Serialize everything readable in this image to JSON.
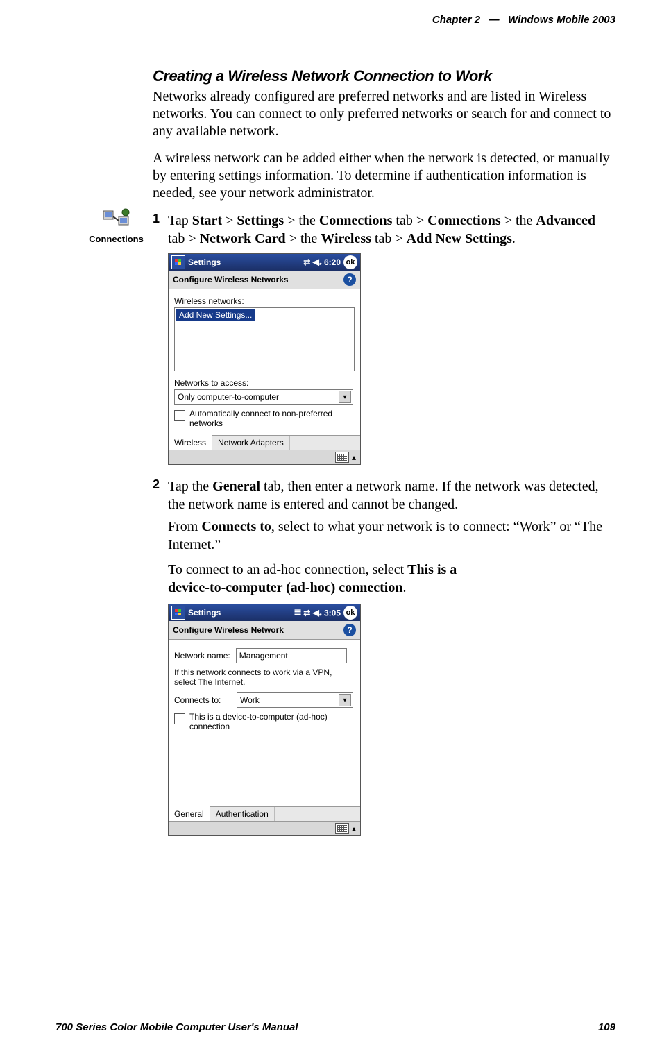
{
  "header": {
    "chapter_label": "Chapter",
    "chapter_number": "2",
    "dash": "—",
    "product": "Windows Mobile 2003"
  },
  "footer": {
    "manual_title": "700 Series Color Mobile Computer User's Manual",
    "page_number": "109"
  },
  "icon": {
    "label": "Connections",
    "name": "connections-icon"
  },
  "section": {
    "title": "Creating a Wireless Network Connection to Work",
    "para1": "Networks already configured are preferred networks and are listed in Wireless networks. You can connect to only preferred networks or search for and connect to any available network.",
    "para2": "A wireless network can be added either when the network is detected, or manually by entering settings information. To determine if authentication information is needed, see your network administrator."
  },
  "step1": {
    "num": "1",
    "parts": {
      "a": "Tap ",
      "start": "Start",
      "b": " > ",
      "settings": "Settings",
      "c": " > the ",
      "connections_tab": "Connections",
      "d": " tab > ",
      "connections": "Connections",
      "e": " > the ",
      "advanced": "Advanced",
      "f": " tab > ",
      "network_card": "Network Card",
      "g": " > the ",
      "wireless": "Wireless",
      "h": " tab > ",
      "add_new": "Add New Settings",
      "i": "."
    }
  },
  "ppc1": {
    "title": "Settings",
    "time": "6:20",
    "ok": "ok",
    "subtitle": "Configure Wireless Networks",
    "lbl_wireless_networks": "Wireless networks:",
    "list_item": "Add New Settings...",
    "lbl_networks_to_access": "Networks to access:",
    "dropdown_value": "Only computer-to-computer",
    "chk_label": "Automatically connect to non-preferred networks",
    "tab_wireless": "Wireless",
    "tab_adapters": "Network Adapters"
  },
  "step2": {
    "num": "2",
    "line1_a": "Tap the ",
    "line1_general": "General",
    "line1_b": " tab, then enter a network name. If the network was detected, the network name is entered and cannot be changed.",
    "line2_a": "From ",
    "line2_connects": "Connects to",
    "line2_b": ", select to what your network is to connect: “Work” or “The Internet.”",
    "line3_a": "To connect to an ad-hoc connection, select ",
    "line3_b1": "This is a",
    "line3_b2": "device-to-computer (ad-hoc) connection",
    "line3_c": "."
  },
  "ppc2": {
    "title": "Settings",
    "time": "3:05",
    "ok": "ok",
    "subtitle": "Configure Wireless Network",
    "lbl_network_name": "Network name:",
    "network_name_value": "Management",
    "hint": "If this network connects to work via a VPN, select The Internet.",
    "lbl_connects_to": "Connects to:",
    "connects_to_value": "Work",
    "chk_label": "This is a device-to-computer (ad-hoc) connection",
    "tab_general": "General",
    "tab_auth": "Authentication"
  }
}
